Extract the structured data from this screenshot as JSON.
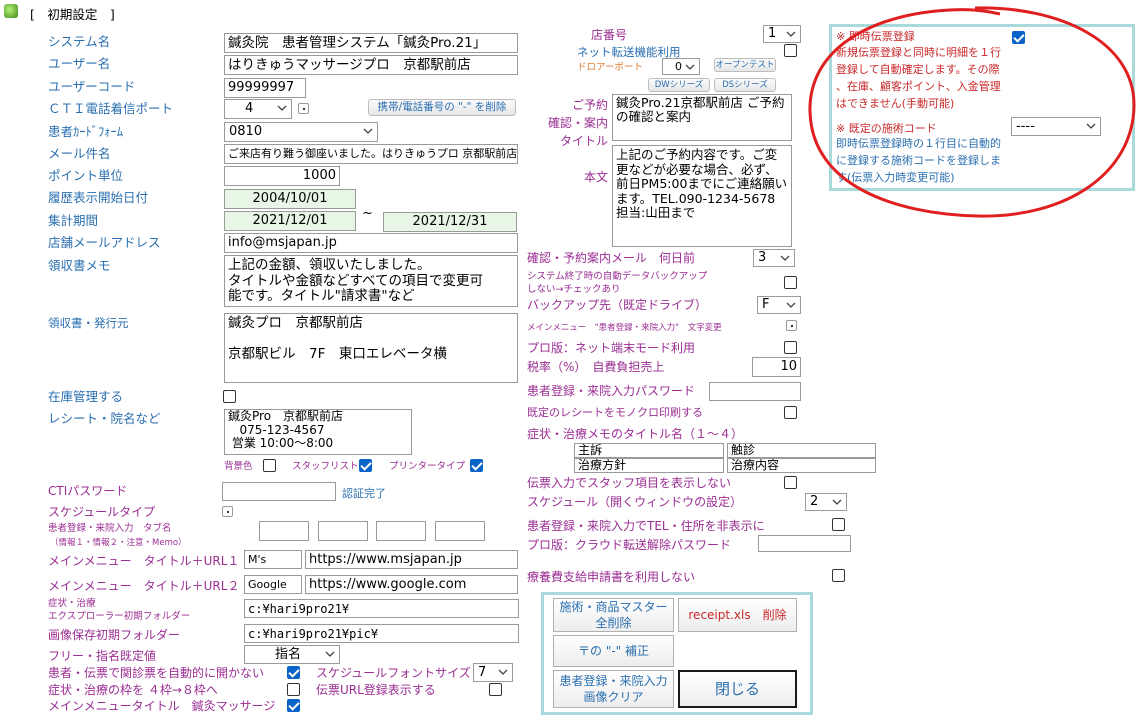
{
  "window": {
    "title": "[　初期設定　]"
  },
  "left": {
    "system_name_label": "システム名",
    "system_name": "鍼灸院　患者管理システム「鍼灸Pro.21」",
    "user_name_label": "ユーザー名",
    "user_name": "はりきゅうマッサージプロ　京都駅前店",
    "user_code_label": "ユーザーコード",
    "user_code": "99999997",
    "cti_port_label": "ＣＴＩ電話着信ポート",
    "cti_port": "4",
    "mobile_btn": "携帯/電話番号の \"-\" を削除",
    "card_form_label": "患者ｶｰﾄﾞﾌｫｰﾑ",
    "card_form": "0810",
    "mail_subject_label": "メール件名",
    "mail_subject": "ご来店有り難う御座いました。はりきゅうプロ 京都駅前店",
    "point_unit_label": "ポイント単位",
    "point_unit": "1000",
    "history_start_label": "履歴表示開始日付",
    "history_start": "2004/10/01",
    "period_label": "集計期間",
    "period_from": "2021/12/01",
    "period_sep": "~",
    "period_to": "2021/12/31",
    "store_mail_label": "店舗メールアドレス",
    "store_mail": "info@msjapan.jp",
    "receipt_memo_label": "領収書メモ",
    "receipt_memo": "上記の金額、領収いたしました。\nタイトルや金額などすべての項目で変更可\n能です。タイトル\"請求書\"など",
    "issuer_label": "領収書・発行元",
    "issuer": "鍼灸プロ　京都駅前店\n\n京都駅ビル　7F　東口エレベータ横",
    "stock_label": "在庫管理する",
    "stock_checked": false,
    "receipt_label": "レシート・院名など",
    "receipt": "鍼灸Pro　京都駅前店\n   075-123-4567\n 営業 10:00～8:00",
    "bg_color_label": "背景色",
    "bg_color_checked": false,
    "staff_list_label": "スタッフリスト",
    "staff_list_checked": true,
    "printer_type_label": "プリンタータイプ",
    "printer_type_checked": true,
    "cti_pw_label": "CTIパスワード",
    "cti_pw": "",
    "auth_done": "認証完了",
    "schedule_type_label": "スケジュールタイプ",
    "tab_name_label": "患者登録・来院入力　タブ名",
    "tab_name_sub": "（情報１・情報２・注意・Memo）",
    "menu_url1_label": "メインメニュー　タイトル＋URL１",
    "menu_url1_title": "M's",
    "menu_url1": "https://www.msjapan.jp",
    "menu_url2_label": "メインメニュー　タイトル＋URL２",
    "menu_url2_title": "Google",
    "menu_url2": "https://www.google.com",
    "explorer_label1": "症状・治療",
    "explorer_label2": "エクスプローラー初期フォルダー",
    "explorer_folder": "c:¥hari9pro21¥",
    "image_folder_label": "画像保存初期フォルダー",
    "image_folder": "c:¥hari9pro21¥pic¥",
    "free_label": "フリー・指名既定値",
    "free_value": "指名",
    "auto_slip_label": "患者・伝票で関診票を自動的に開かない",
    "auto_slip_checked": true,
    "frame_label": "症状・治療の枠を ４枠→８枠へ",
    "frame_checked": false,
    "menu_title_label": "メインメニュータイトル　鍼灸マッサージ",
    "menu_title_checked": true,
    "sched_font_label": "スケジュールフォントサイズ",
    "sched_font": "7",
    "slip_url_label": "伝票URL登録表示する",
    "slip_url_checked": false
  },
  "mid": {
    "store_no_label": "店番号",
    "store_no": "1",
    "net_forward_label": "ネット転送機能利用",
    "net_forward_checked": false,
    "drawer_label": "ドロアーポート",
    "drawer": "0",
    "open_test": "オープンテスト",
    "dw_series": "DWシリーズ",
    "ds_series": "DSシリーズ",
    "reserve_label": "ご予約\n確認・案内\nタイトル",
    "reserve_title": "鍼灸Pro.21京都駅前店 ご予約の確認と案内",
    "body_label": "本文",
    "body_text": "上記のご予約内容です。ご変更などが必要な場合、必ず、前日PM5:00までにご連絡願います。TEL.090-1234-5678 担当:山田まで",
    "confirm_days_label": "確認・予約案内メール　何日前",
    "confirm_days": "3",
    "auto_backup_label1": "システム終了時の自動データバックアップ",
    "auto_backup_label2": "しない→チェックあり",
    "auto_backup_checked": false,
    "backup_drive_label": "バックアップ先（既定ドライブ）",
    "backup_drive": "F",
    "main_menu_text_label": "メインメニュー　\"患者登録・来院入力\"　文字変更",
    "pro_net_label": "プロ版：ネット端末モード利用",
    "pro_net_checked": false,
    "tax_label": "税率（%）　自費負担売上",
    "tax": "10",
    "patient_pw_label": "患者登録・来院入力パスワード",
    "patient_pw": "",
    "mono_print_label": "既定のレシートをモノクロ印刷する",
    "mono_print_checked": false,
    "memo_title_label": "症状・治療メモのタイトル名（１～４）",
    "memo_titles": [
      "主訴",
      "触診",
      "治療方針",
      "治療内容"
    ],
    "no_staff_label": "伝票入力でスタッフ項目を表示しない",
    "no_staff_checked": false,
    "schedule_label": "スケジュール（開くウィンドウの設定）",
    "schedule": "2",
    "hide_tel_label": "患者登録・来院入力でTEL・住所を非表示に",
    "hide_tel_checked": false,
    "cloud_pw_label": "プロ版：クラウド転送解除パスワード",
    "cloud_pw": "",
    "medical_label": "療養費支給申請書を利用しない",
    "medical_checked": false
  },
  "right": {
    "instant_label": "※ 即時伝票登録",
    "instant_checked": true,
    "instant_desc": "新規伝票登録と同時に明細を１行\n登録して自動確定します。その際\n、在庫、顧客ポイント、入金管理\nはできません(手動可能)",
    "default_code_label": "※ 既定の施術コード",
    "default_code": "----",
    "default_code_desc": "即時伝票登録時の１行目に自動的\nに登録する施術コードを登録しま\nす(伝票入力時変更可能)"
  },
  "buttons": {
    "clear_master": "施術・商品マスター\n全削除",
    "delete_receipt": "receipt.xls　削除",
    "postal_fix": "〒の \"-\" 補正",
    "clear_image": "患者登録・来院入力\n画像クリア",
    "close": "閉じる"
  },
  "colors": {
    "label_blue": "#2a6fb0",
    "label_purple": "#9b2d93",
    "panel_border": "#a8dadc",
    "annotation_red": "#e02020"
  }
}
